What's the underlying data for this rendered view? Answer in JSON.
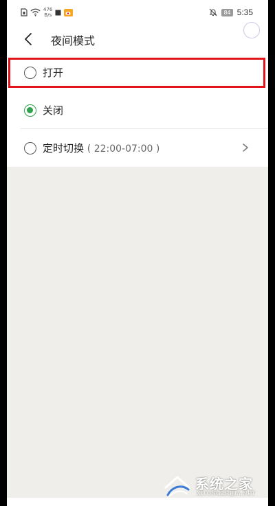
{
  "status_bar": {
    "net_speed_value": "476",
    "net_speed_unit": "B/s",
    "battery": "84",
    "time": "5:35"
  },
  "header": {
    "title": "夜间模式"
  },
  "options": [
    {
      "label": "打开",
      "checked": false
    },
    {
      "label": "关闭",
      "checked": true
    },
    {
      "label": "定时切换",
      "hint": "( 22:00-07:00 )",
      "checked": false
    }
  ],
  "watermark": {
    "cn": "系统之家",
    "en": "XITONGZHIJIA.NET"
  },
  "colors": {
    "accent_green": "#2fa14a",
    "highlight_red": "#e1141b",
    "page_bg": "#efeeea"
  }
}
